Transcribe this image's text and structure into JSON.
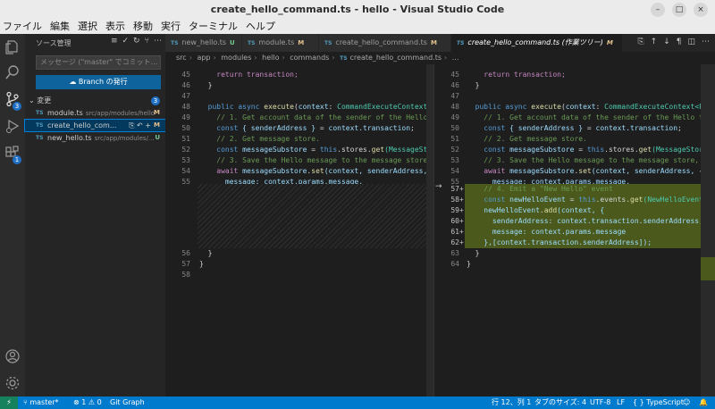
{
  "window": {
    "title": "create_hello_command.ts - hello - Visual Studio Code"
  },
  "menu": [
    "ファイル",
    "編集",
    "選択",
    "表示",
    "移動",
    "実行",
    "ターミナル",
    "ヘルプ"
  ],
  "activity": {
    "scm_badge": "3",
    "ext_badge": "1"
  },
  "sidebar": {
    "title": "ソース管理",
    "commit_placeholder": "メッセージ (\"master\" でコミット...",
    "publish_label": "Branch の発行",
    "changes_label": "変更",
    "changes_count": "3",
    "files": [
      {
        "name": "module.ts",
        "path": "src/app/modules/hello",
        "status": "M"
      },
      {
        "name": "create_hello_com...",
        "path": "",
        "status": "M"
      },
      {
        "name": "new_hello.ts",
        "path": "src/app/modules/...",
        "status": "U"
      }
    ]
  },
  "tabs": [
    {
      "icon": "TS",
      "label": "new_hello.ts",
      "status": "U"
    },
    {
      "icon": "TS",
      "label": "module.ts",
      "status": "M"
    },
    {
      "icon": "TS",
      "label": "create_hello_command.ts",
      "status": "M"
    },
    {
      "icon": "TS",
      "label": "create_hello_command.ts (作業ツリー)",
      "status": "M"
    }
  ],
  "breadcrumb": [
    "src",
    "app",
    "modules",
    "hello",
    "commands",
    "create_hello_command.ts",
    "..."
  ],
  "code": {
    "left_numbers_top": [
      "45",
      "46",
      "47",
      "48",
      "49",
      "50",
      "51",
      "52",
      "53",
      "54",
      "55"
    ],
    "left_numbers_bottom": [
      "56",
      "57",
      "58"
    ],
    "right_numbers": [
      "45",
      "46",
      "47",
      "48",
      "49",
      "50",
      "51",
      "52",
      "53",
      "54",
      "55",
      "57",
      "58",
      "59",
      "60",
      "61",
      "62",
      "63",
      "64"
    ],
    "l45": "    return transaction;",
    "l46": "  }",
    "l48_a": "  public async ",
    "l48_b": "execute",
    "l48_c": "(",
    "l48_d": "context",
    "l48_e": ": ",
    "l48_f": "CommandExecuteContext",
    "l48_g": "<Params",
    "l49": "    // 1. Get account data of the sender of the Hello transaction.",
    "l50_a": "    const ",
    "l50_b": "{ senderAddress }",
    "l50_c": " = ",
    "l50_d": "context.transaction",
    "l50_e": ";",
    "l51": "    // 2. Get message store.",
    "l52_a": "    const ",
    "l52_b": "messageSubstore",
    "l52_c": " = ",
    "l52_d": "this",
    "l52_e": ".stores.",
    "l52_f": "get",
    "l52_g": "(MessageStore);",
    "l53": "    // 3. Save the Hello message to the message store, using the sender",
    "l54_a": "    await ",
    "l54_b": "messageSubstore",
    "l54_c": ".",
    "l54_d": "set",
    "l54_e": "(context, senderAddress, {",
    "l55": "      message: context.params.message,",
    "l56": "    });",
    "l57": "  }",
    "l58": "}",
    "r57": "    // 4. Emit a \"New Hello\" event",
    "r58_a": "    const ",
    "r58_b": "newHelloEvent",
    "r58_c": " = ",
    "r58_d": "this",
    "r58_e": ".events.",
    "r58_f": "get",
    "r58_g": "(NewHelloEvent);",
    "r59_a": "    newHelloEvent",
    "r59_b": ".",
    "r59_c": "add",
    "r59_d": "(context, {",
    "r60": "      senderAddress: context.transaction.senderAddress,",
    "r61": "      message: context.params.message",
    "r62": "    },[context.transaction.senderAddress]);",
    "r63": "  }",
    "r64": "}",
    "arrow": "→"
  },
  "statusbar": {
    "branch": "master*",
    "errors": "⊗ 1 ⚠ 0",
    "git_graph": "Git Graph",
    "position": "行 12、列 1",
    "tab_size": "タブのサイズ: 4",
    "encoding": "UTF-8",
    "eol": "LF",
    "language": "{ } TypeScript"
  }
}
